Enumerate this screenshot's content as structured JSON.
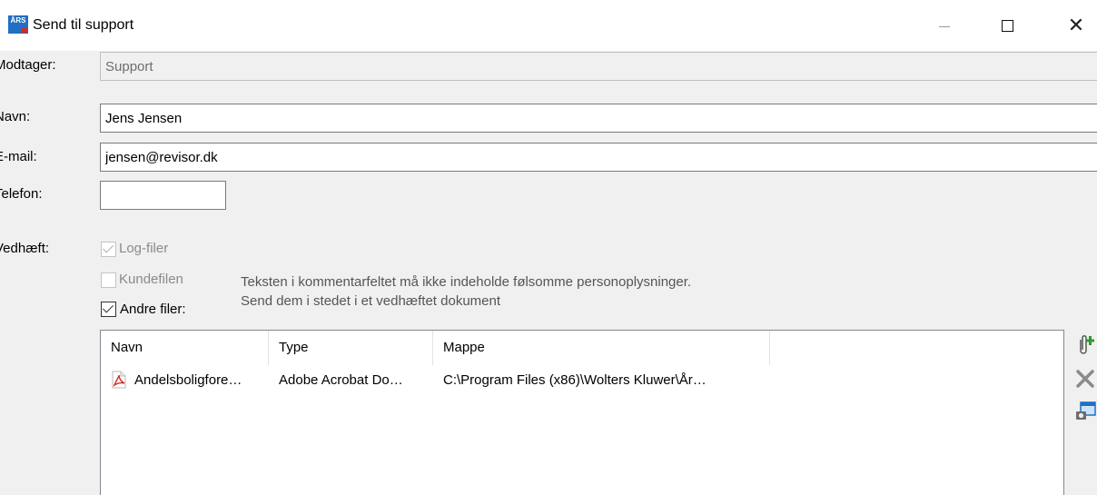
{
  "window": {
    "title": "Send til support",
    "app_icon_text": "ÅRS",
    "close_glyph": "✕"
  },
  "form": {
    "recipient": {
      "label": "Modtager:",
      "value": "Support"
    },
    "name": {
      "label": "Navn:",
      "value": "Jens Jensen"
    },
    "email": {
      "label": "E-mail:",
      "value": "jensen@revisor.dk"
    },
    "phone": {
      "label": "Telefon:",
      "value": ""
    },
    "attach_label": "Vedhæft:"
  },
  "attachments": {
    "log_files": {
      "label": "Log-filer",
      "checked": true,
      "enabled": false
    },
    "customer_file": {
      "label": "Kundefilen",
      "checked": false,
      "enabled": false
    },
    "other_files": {
      "label": "Andre filer:",
      "checked": true,
      "enabled": true
    }
  },
  "notice": {
    "line1": "Teksten i kommentarfeltet må ikke indeholde følsomme personoplysninger.",
    "line2": "Send dem i stedet i et vedhæftet dokument"
  },
  "file_list": {
    "columns": [
      "Navn",
      "Type",
      "Mappe"
    ],
    "rows": [
      {
        "name": "Andelsboligfore…",
        "type": "Adobe Acrobat Do…",
        "folder": "C:\\Program Files (x86)\\Wolters Kluwer\\År…",
        "icon": "pdf-icon"
      }
    ]
  },
  "tools": {
    "icons": [
      "add-attachment-icon",
      "remove-icon",
      "screenshot-icon"
    ],
    "colors": {
      "remove": "#8a8a8a",
      "accent": "#1f6fc2",
      "pdf": "#d42a2a"
    }
  }
}
